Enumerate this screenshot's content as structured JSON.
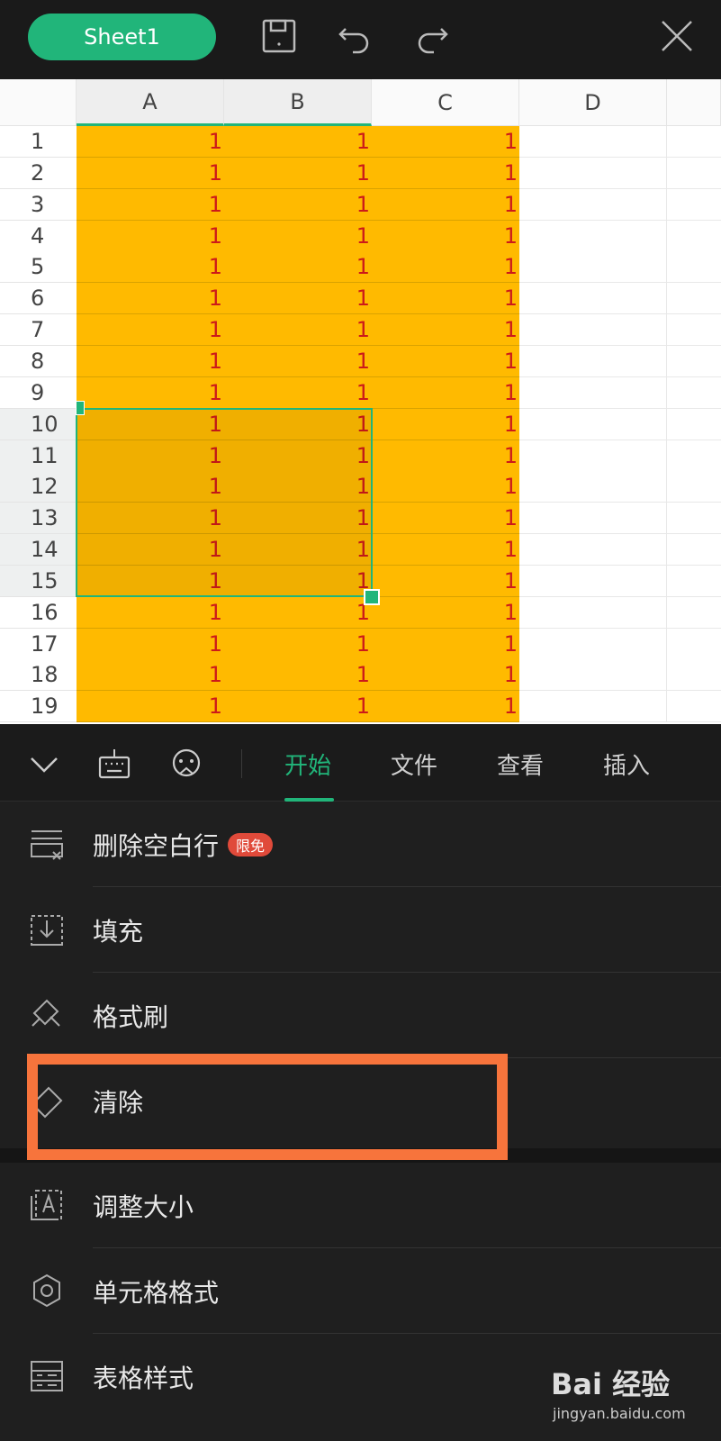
{
  "topbar": {
    "sheet_name": "Sheet1",
    "icons": [
      "save-icon",
      "undo-icon",
      "redo-icon",
      "close-icon"
    ]
  },
  "grid": {
    "columns": [
      "A",
      "B",
      "C",
      "D"
    ],
    "rows": [
      "1",
      "2",
      "3",
      "4",
      "5",
      "6",
      "7",
      "8",
      "9",
      "10",
      "11",
      "12",
      "13",
      "14",
      "15",
      "16",
      "17",
      "18",
      "19"
    ],
    "cell_value": "1",
    "fill_color": "#FFBA00",
    "selection": "A10:B15"
  },
  "toolbar": {
    "tabs": [
      "开始",
      "文件",
      "查看",
      "插入"
    ],
    "active_tab": "开始"
  },
  "menu": {
    "items": [
      {
        "label": "删除空白行",
        "badge": "限免",
        "icon": "delete-blank-rows-icon"
      },
      {
        "label": "填充",
        "icon": "fill-icon"
      },
      {
        "label": "格式刷",
        "icon": "format-painter-icon"
      },
      {
        "label": "清除",
        "icon": "eraser-icon"
      },
      {
        "label": "调整大小",
        "icon": "resize-icon"
      },
      {
        "label": "单元格格式",
        "icon": "gear-icon"
      },
      {
        "label": "表格样式",
        "icon": "table-style-icon"
      }
    ]
  },
  "accent_color": "#21B57A",
  "highlight_color": "#F7743C",
  "watermark": {
    "brand": "Bai 经验",
    "url": "jingyan.baidu.com"
  }
}
